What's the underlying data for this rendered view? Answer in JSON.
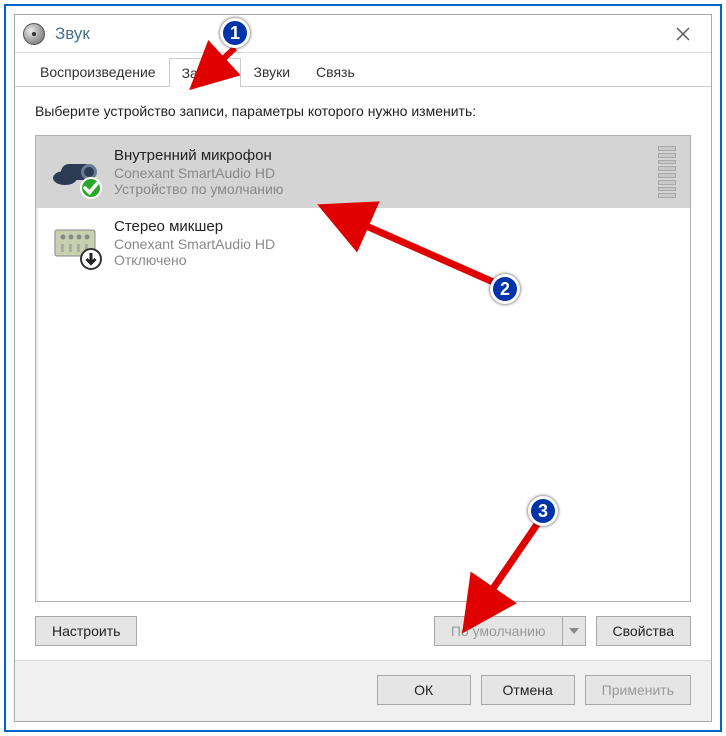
{
  "window": {
    "title": "Звук"
  },
  "tabs": [
    {
      "label": "Воспроизведение",
      "active": false
    },
    {
      "label": "Запись",
      "active": true
    },
    {
      "label": "Звуки",
      "active": false
    },
    {
      "label": "Связь",
      "active": false
    }
  ],
  "instruction": "Выберите устройство записи, параметры которого нужно изменить:",
  "devices": [
    {
      "name": "Внутренний микрофон",
      "sub1": "Conexant SmartAudio HD",
      "sub2": "Устройство по умолчанию",
      "selected": true,
      "state": "default"
    },
    {
      "name": "Стерео микшер",
      "sub1": "Conexant SmartAudio HD",
      "sub2": "Отключено",
      "selected": false,
      "state": "disabled"
    }
  ],
  "buttons": {
    "configure": "Настроить",
    "set_default": "По умолчанию",
    "properties": "Свойства",
    "ok": "ОК",
    "cancel": "Отмена",
    "apply": "Применить"
  },
  "callouts": {
    "1": "1",
    "2": "2",
    "3": "3"
  }
}
